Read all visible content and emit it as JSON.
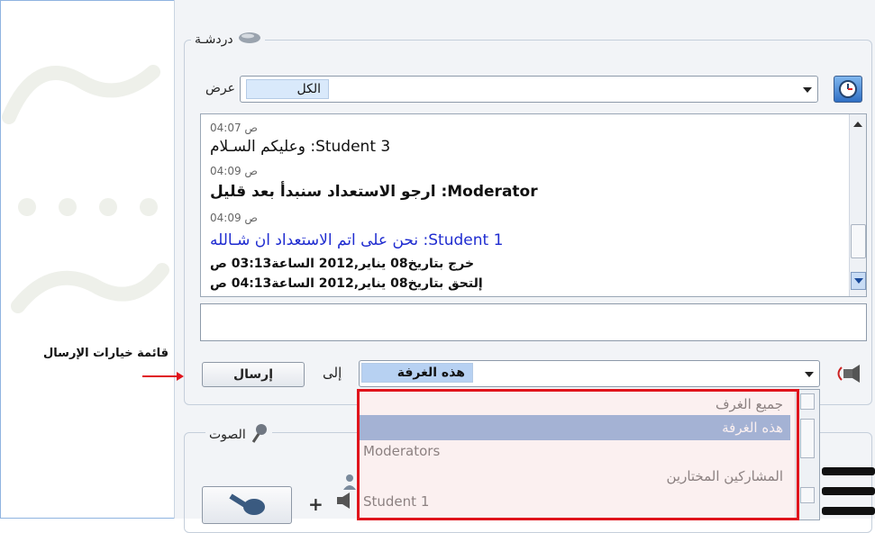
{
  "chat": {
    "title": "دردشـة",
    "view_label": "عرض",
    "filter_value": "الكل",
    "messages": [
      {
        "time": "ص 04:07",
        "text": "وعليكم السـلام :Student 3",
        "style": "normal"
      },
      {
        "time": "ص 04:09",
        "text": "ارجو الاستعداد سنبدأ بعد قليل :Moderator",
        "style": "bold"
      },
      {
        "time": "ص 04:09",
        "text": "نحن على اتم الاستعداد ان شـالله :Student 1",
        "style": "blue"
      }
    ],
    "events": [
      "خرج بتاريخ08  يناير,2012  الساعة03:13 ص",
      "إلتحق بتاريخ08  يناير,2012  الساعة04:13 ص"
    ],
    "message_input_value": "",
    "send_button_label": "إرسال",
    "to_label": "إلى",
    "recipient_value": "هذه الغرفة",
    "recipient_options": [
      "جميع الغرف",
      "هذه الغرفة",
      "Moderators",
      "المشاركين المختارين",
      "Student 1"
    ],
    "recipient_selected_index": 1
  },
  "audio": {
    "title": "الصوت"
  },
  "annotation": {
    "label": "قائمة خيارات الإرسال"
  },
  "colors": {
    "highlight_red": "#e0141c",
    "selection_blue": "#87a9d9",
    "moderator_blue": "#1f2cd0"
  }
}
